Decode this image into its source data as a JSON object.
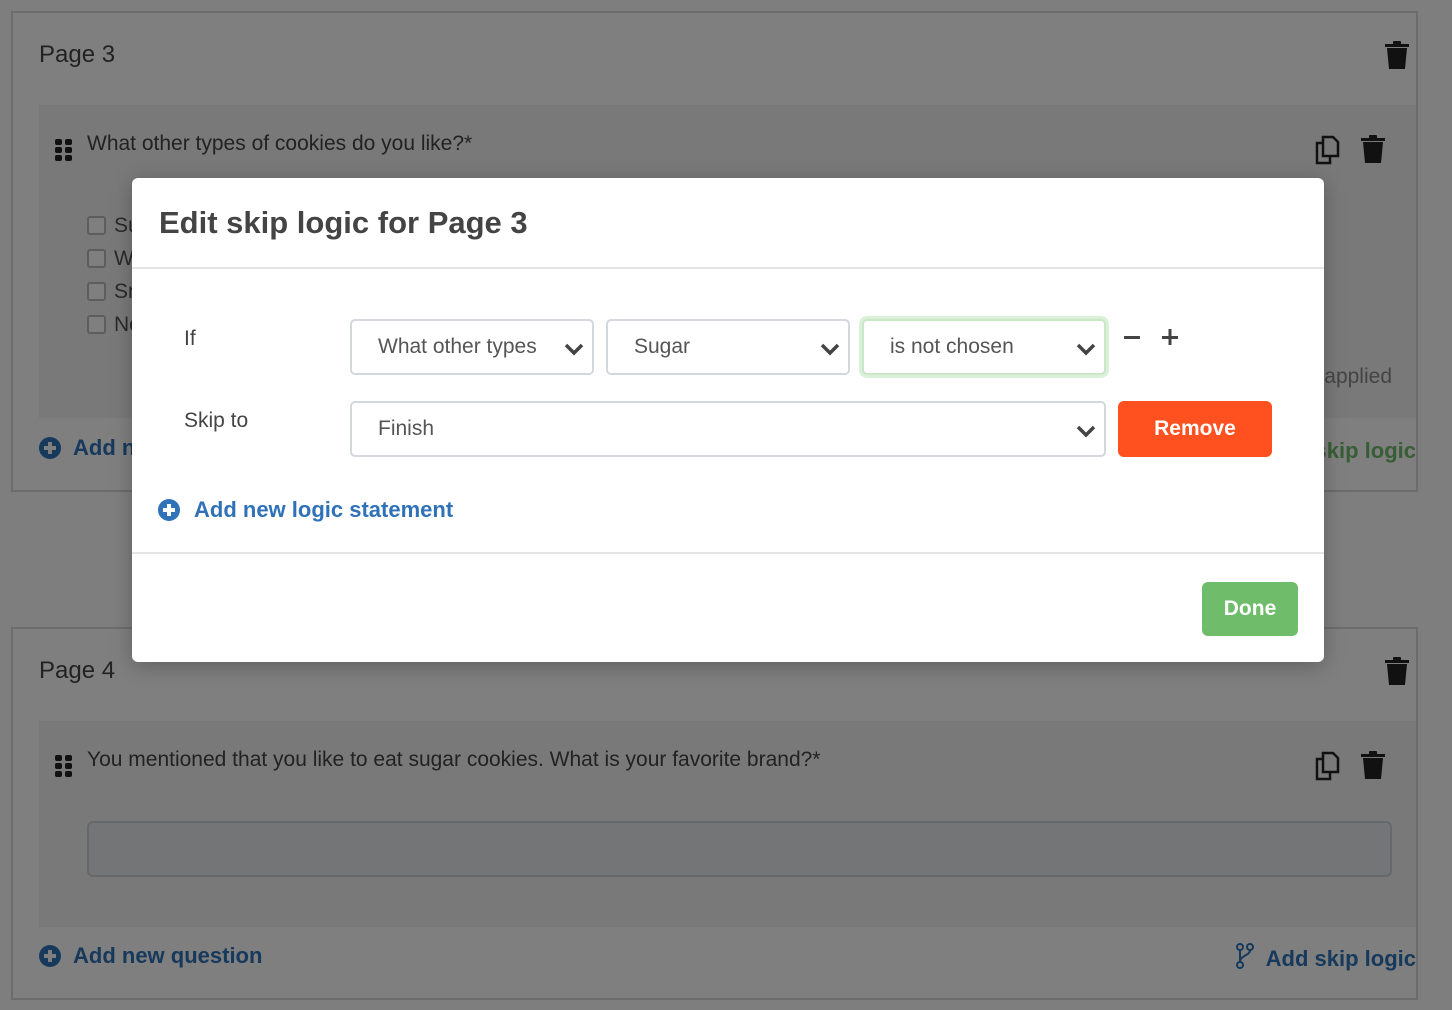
{
  "pages": [
    {
      "title": "Page 3",
      "question": {
        "text": "What other types of cookies do you like?*",
        "options": [
          "Sugar",
          "White chocolate macadamia",
          "Snickerdoodle",
          "None"
        ],
        "note": "Skip logic applied"
      },
      "add_question_label": "Add new question",
      "skip_logic_label": "Edit skip logic"
    },
    {
      "title": "Page 4",
      "question": {
        "text": "You mentioned that you like to eat sugar cookies. What is your favorite brand?*",
        "input_value": ""
      },
      "add_question_label": "Add new question",
      "skip_logic_label": "Add skip logic"
    }
  ],
  "modal": {
    "title": "Edit skip logic for Page 3",
    "if_label": "If",
    "skip_to_label": "Skip to",
    "condition": {
      "question": "What other types",
      "answer": "Sugar",
      "operator": "is not chosen"
    },
    "skip_to": "Finish",
    "remove_label": "Remove",
    "add_statement_label": "Add new logic statement",
    "done_label": "Done",
    "minus_symbol": "−",
    "plus_symbol": "+"
  },
  "colors": {
    "primary_blue": "#2f72b8",
    "success_green": "#6fbc6b",
    "danger_orange": "#ff5020"
  }
}
